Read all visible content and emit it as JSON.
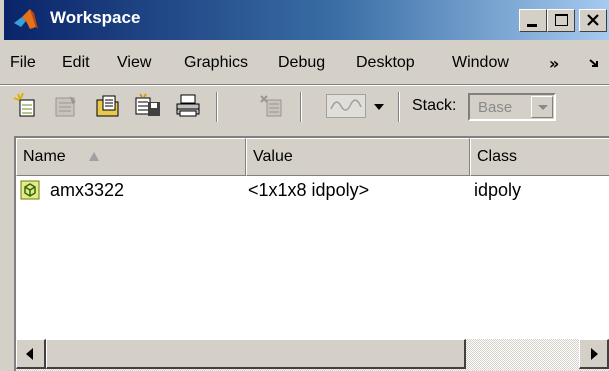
{
  "window": {
    "title": "Workspace",
    "colors": {
      "titlebar_start": "#0a246a",
      "titlebar_end": "#a6caf0",
      "chrome": "#d4d0c8"
    }
  },
  "menu": {
    "items": [
      "File",
      "Edit",
      "View",
      "Graphics",
      "Debug",
      "Desktop",
      "Window"
    ],
    "overflow": "»",
    "extra_icon": "dock-arrow-icon"
  },
  "toolbar": {
    "buttons": [
      "new-variable-icon",
      "open-variable-icon",
      "import-data-icon",
      "save-workspace-icon",
      "print-icon",
      "delete-icon",
      "plot-selection-icon"
    ],
    "stack_label": "Stack:",
    "stack_value": "Base"
  },
  "table": {
    "columns": [
      "Name",
      "Value",
      "Class"
    ],
    "sorted_column": "Name",
    "rows": [
      {
        "name": "amx3322",
        "value": "<1x1x8 idpoly>",
        "class": "idpoly",
        "icon": "object-icon"
      }
    ]
  }
}
